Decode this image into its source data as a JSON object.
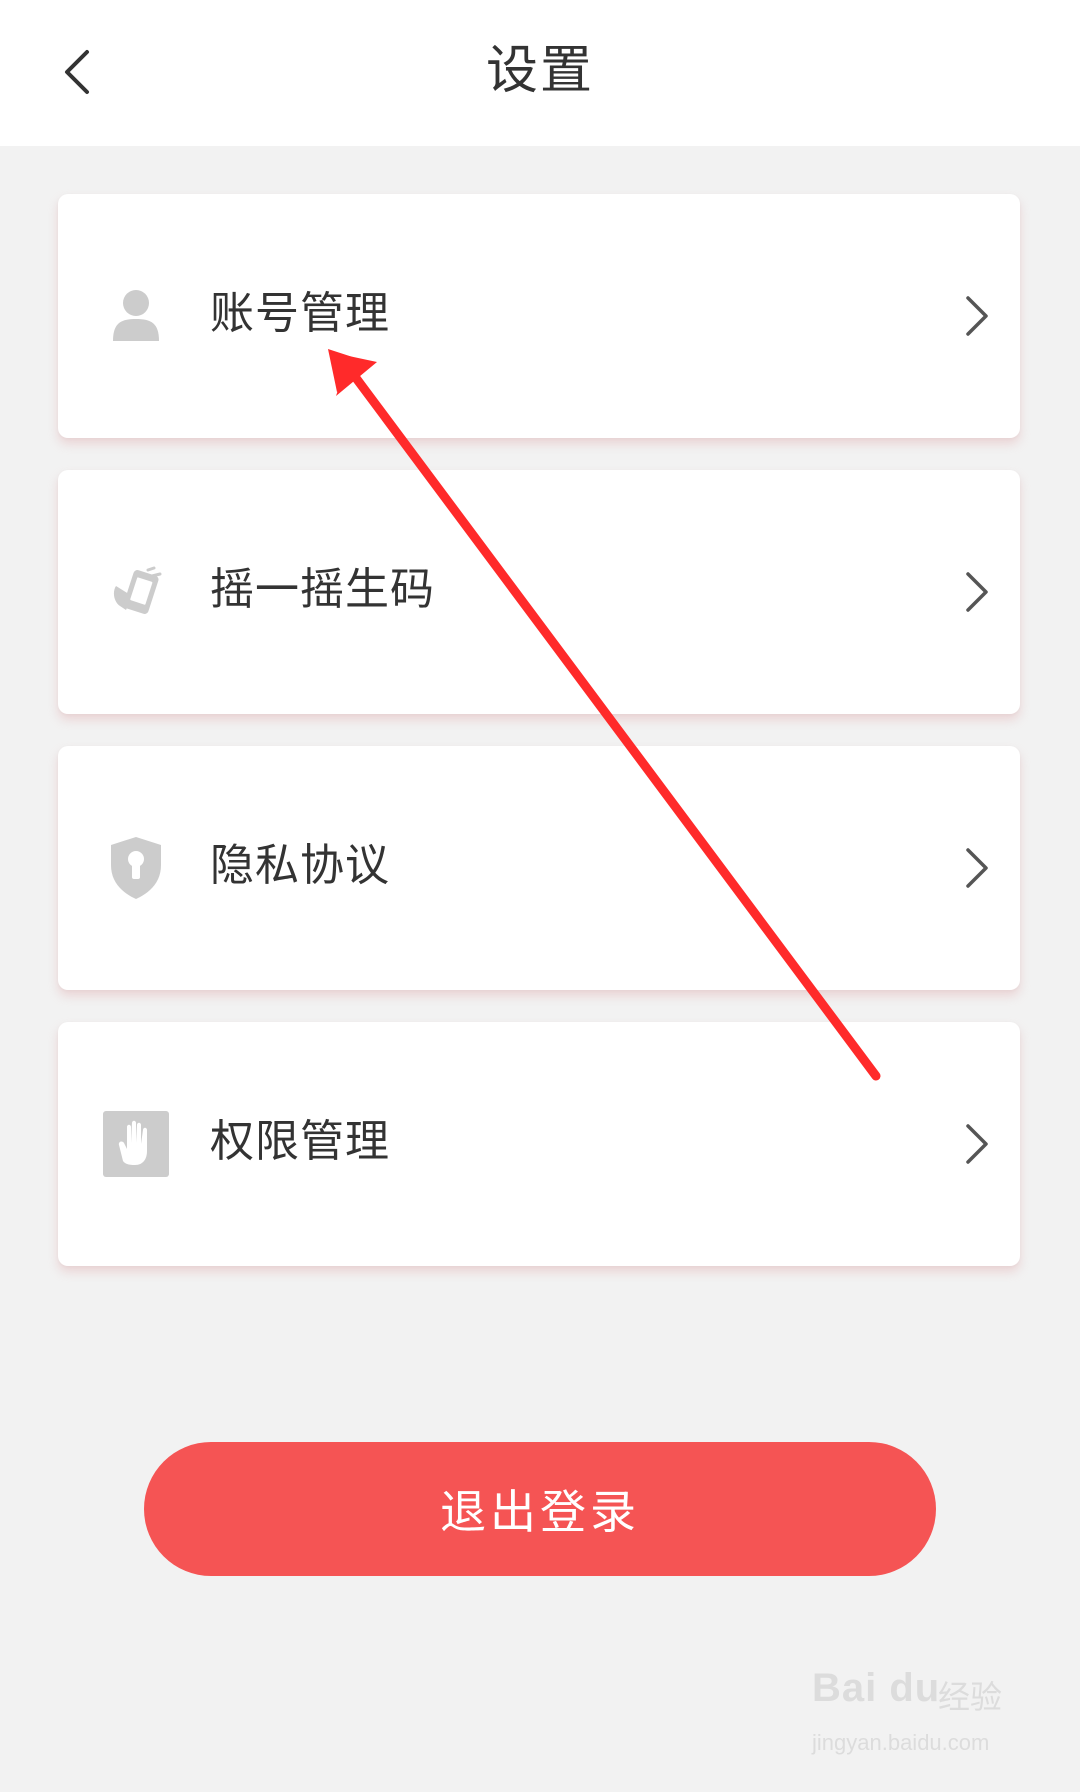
{
  "header": {
    "title": "设置",
    "back_icon": "chevron-left-icon"
  },
  "menu": {
    "items": [
      {
        "label": "账号管理",
        "icon": "user-icon"
      },
      {
        "label": "摇一摇生码",
        "icon": "shake-phone-icon"
      },
      {
        "label": "隐私协议",
        "icon": "shield-lock-icon"
      },
      {
        "label": "权限管理",
        "icon": "hand-icon"
      }
    ]
  },
  "logout": {
    "label": "退出登录"
  },
  "watermark": {
    "logo": "Bai du",
    "cn": "经验",
    "url": "jingyan.baidu.com"
  },
  "colors": {
    "accent": "#f55454",
    "background": "#f2f2f2",
    "icon_gray": "#cccccc",
    "annotation_arrow": "#ff2a2a"
  }
}
